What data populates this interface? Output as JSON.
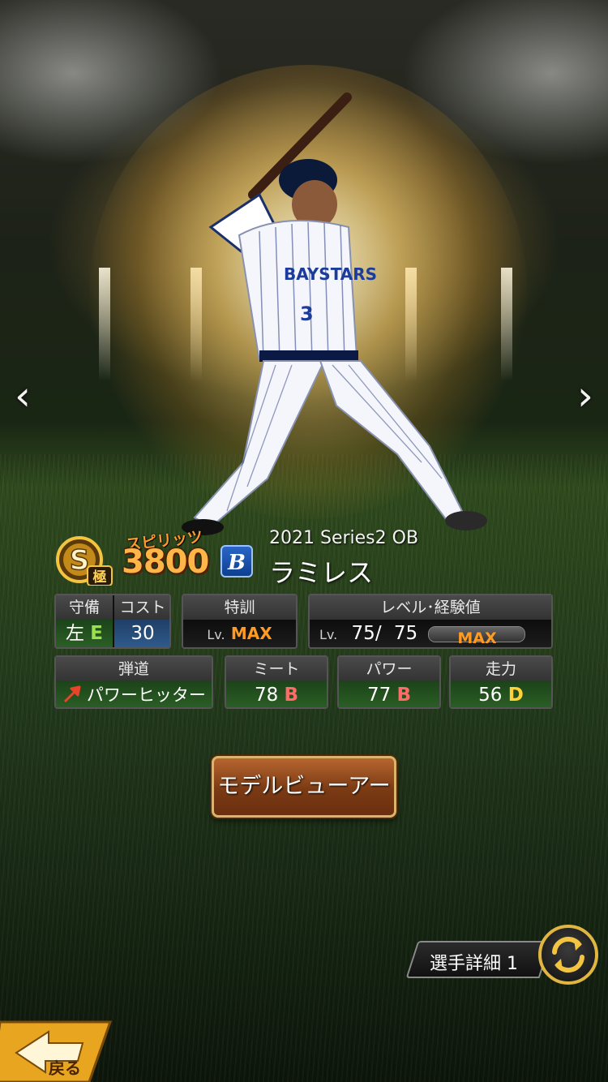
{
  "player": {
    "series": "2021 Series2 OB",
    "name": "ラミレス",
    "team_logo_letter": "B"
  },
  "spirits": {
    "label": "スピリッツ",
    "value": "3800"
  },
  "rank_badge": {
    "letter": "S",
    "sub": "極"
  },
  "stats": {
    "defense": {
      "header": "守備",
      "position": "左",
      "grade": "E"
    },
    "cost": {
      "header": "コスト",
      "value": "30"
    },
    "training": {
      "header": "特訓",
      "lv_prefix": "Lv.",
      "value": "MAX"
    },
    "level": {
      "header": "レベル･経験値",
      "lv_prefix": "Lv.",
      "current": "75",
      "separator": "/",
      "max": "75",
      "exp_label": "MAX",
      "exp_fill": 1.0
    },
    "trajectory": {
      "header": "弾道",
      "value": "パワーヒッター"
    },
    "meet": {
      "header": "ミート",
      "value": "78",
      "grade": "B"
    },
    "power": {
      "header": "パワー",
      "value": "77",
      "grade": "B"
    },
    "speed": {
      "header": "走力",
      "value": "56",
      "grade": "D"
    }
  },
  "buttons": {
    "model_viewer": "モデルビューアー",
    "player_detail": "選手詳細 1",
    "back": "戻る"
  },
  "nav": {
    "prev": "‹",
    "next": "›"
  },
  "colors": {
    "accent_orange": "#ff9a22",
    "grade_e": "#9be04d",
    "grade_b": "#ff6a6a",
    "grade_d": "#ffd23a",
    "button_gold": "#e0b640"
  },
  "icons": [
    "rank-s-icon",
    "team-logo-icon",
    "trajectory-arrow-icon",
    "swap-icon",
    "back-arrow-icon",
    "chevron-left-icon",
    "chevron-right-icon"
  ]
}
